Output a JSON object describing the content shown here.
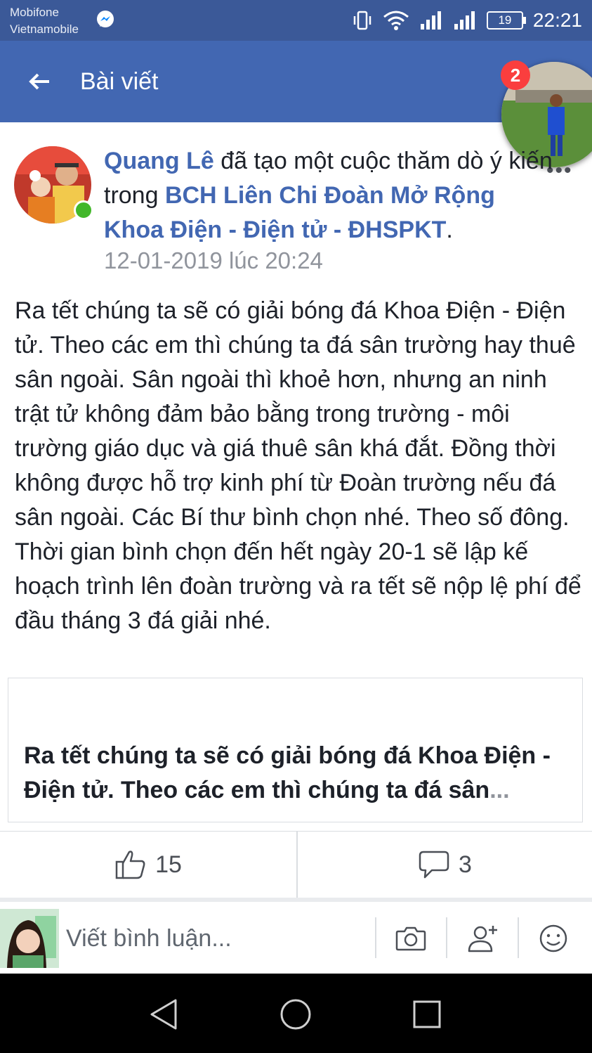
{
  "status_bar": {
    "carrier_1": "Mobifone",
    "carrier_2": "Vietnamobile",
    "battery": "19",
    "time": "22:21"
  },
  "app_bar": {
    "title": "Bài viết"
  },
  "chat_head": {
    "badge_count": "2"
  },
  "post": {
    "author": "Quang Lê",
    "action_text": " đã tạo một cuộc thăm dò ý kiến trong ",
    "group": "BCH Liên Chi Đoàn Mở Rộng Khoa Điện - Điện tử - ĐHSPKT",
    "period": ".",
    "timestamp": "12-01-2019 lúc 20:24",
    "body": "Ra tết chúng ta sẽ có giải bóng đá Khoa Điện - Điện tử. Theo các em thì chúng ta đá sân trường hay thuê sân ngoài. Sân ngoài thì khoẻ hơn, nhưng an ninh trật tử không đảm bảo bằng trong trường - môi trường giáo dục và giá thuê sân khá đắt. Đồng thời không được hỗ trợ kinh phí từ Đoàn trường nếu đá sân ngoài. Các Bí thư bình chọn nhé. Theo số đông. Thời gian bình chọn đến hết ngày 20-1 sẽ lập kế hoạch trình lên đoàn trường và ra tết sẽ nộp lệ phí để đầu tháng 3 đá giải nhé.",
    "card_title": "Ra tết chúng ta sẽ có giải bóng đá Khoa Điện - Điện tử. Theo các em thì chúng ta đá sân",
    "card_ellipsis": "..."
  },
  "actions": {
    "like_count": "15",
    "comment_count": "3"
  },
  "comment_bar": {
    "placeholder": "Viết bình luận..."
  },
  "colors": {
    "status_bar": "#3b5998",
    "app_bar": "#4267b2",
    "link": "#4267b2",
    "online": "#42b72a",
    "badge": "#fa3e3e"
  }
}
